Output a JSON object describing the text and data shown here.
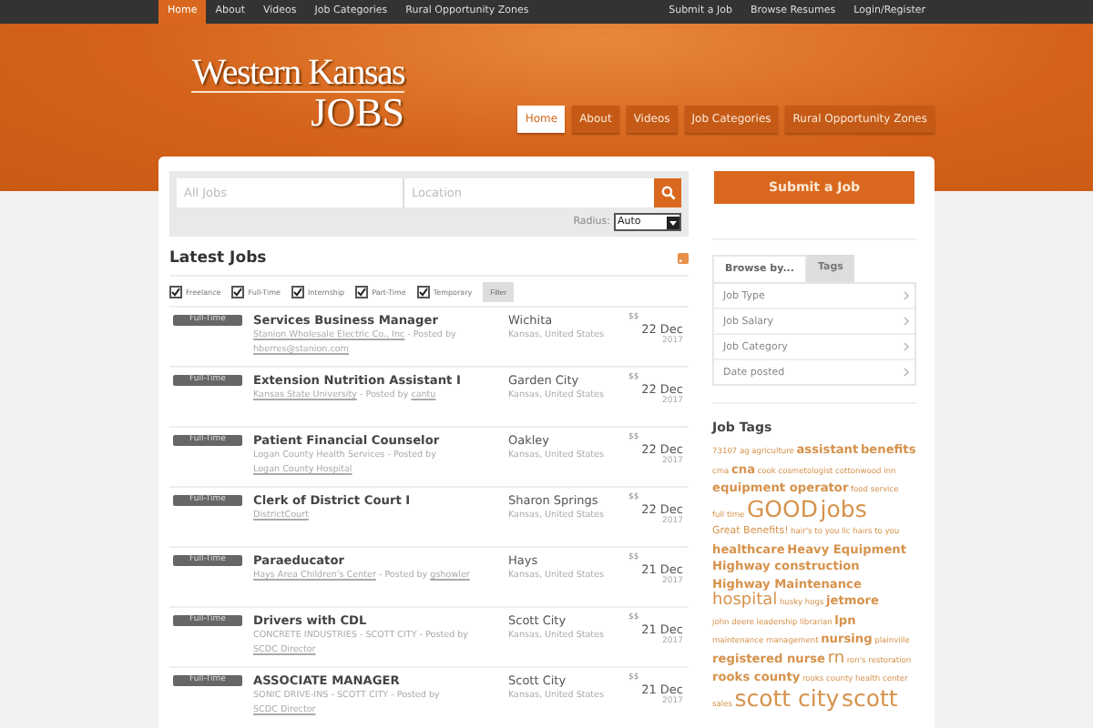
{
  "top_bar": {
    "left": [
      {
        "label": "Home",
        "selected": true
      },
      {
        "label": "About",
        "selected": false
      },
      {
        "label": "Videos",
        "selected": false
      },
      {
        "label": "Job Categories",
        "selected": false
      },
      {
        "label": "Rural Opportunity Zones",
        "selected": false
      }
    ],
    "right": [
      "Submit a Job",
      "Browse Resumes",
      "Login/Register"
    ]
  },
  "header": {
    "logo_line_1": "Western Kansas",
    "logo_line_2": "JOBS",
    "nav": [
      {
        "label": "Home",
        "selected": true
      },
      {
        "label": "About",
        "selected": false
      },
      {
        "label": "Videos",
        "selected": false
      },
      {
        "label": "Job Categories",
        "selected": false
      },
      {
        "label": "Rural Opportunity Zones",
        "selected": false
      }
    ]
  },
  "search": {
    "keywords_placeholder": "All Jobs",
    "location_placeholder": "Location",
    "radius_label": "Radius:",
    "radius_value": "Auto"
  },
  "latest": {
    "title": "Latest Jobs",
    "filters": [
      {
        "label": "Freelance",
        "checked": true
      },
      {
        "label": "Full-Time",
        "checked": true
      },
      {
        "label": "Internship",
        "checked": true
      },
      {
        "label": "Part-Time",
        "checked": true
      },
      {
        "label": "Temporary",
        "checked": true
      }
    ],
    "filter_button": "Filter",
    "jobs": [
      {
        "type": "Full-Time",
        "title": "Services Business Manager",
        "company": "Stanion Wholesale Electric Co., Inc",
        "company_link": true,
        "posted_label": " - Posted by ",
        "poster": "hberres@stanion.com",
        "city": "Wichita",
        "region": "Kansas, United States",
        "salary": "$$",
        "date": "22 Dec",
        "year": "2017"
      },
      {
        "type": "Full-Time",
        "title": "Extension Nutrition Assistant I",
        "company": "Kansas State University",
        "company_link": true,
        "posted_label": " - Posted by ",
        "poster": "cantu",
        "city": "Garden City",
        "region": "Kansas, United States",
        "salary": "$$",
        "date": "22 Dec",
        "year": "2017"
      },
      {
        "type": "Full-Time",
        "title": "Patient Financial Counselor",
        "company": "Logan County Health Services",
        "company_link": false,
        "posted_label": " - Posted by ",
        "poster": "Logan County Hospital",
        "city": "Oakley",
        "region": "Kansas, United States",
        "salary": "$$",
        "date": "22 Dec",
        "year": "2017"
      },
      {
        "type": "Full-Time",
        "title": "Clerk of District Court I",
        "company": "DistrictCourt",
        "company_link": true,
        "city": "Sharon Springs",
        "region": "Kansas, United States",
        "salary": "$$",
        "date": "22 Dec",
        "year": "2017"
      },
      {
        "type": "Full-Time",
        "title": "Paraeducator",
        "company": "Hays Area Children's Center",
        "company_link": true,
        "posted_label": " - Posted by ",
        "poster": "gshowler",
        "city": "Hays",
        "region": "Kansas, United States",
        "salary": "$$",
        "date": "21 Dec",
        "year": "2017"
      },
      {
        "type": "Full-Time",
        "title": "Drivers with CDL",
        "company": "CONCRETE INDUSTRIES - SCOTT CITY",
        "company_link": false,
        "posted_label": " - Posted by ",
        "poster": "SCDC Director",
        "city": "Scott City",
        "region": "Kansas, United States",
        "salary": "$$",
        "date": "21 Dec",
        "year": "2017"
      },
      {
        "type": "Full-Time",
        "title": "ASSOCIATE MANAGER",
        "company": "SONIC DRIVE-INS - SCOTT CITY",
        "company_link": false,
        "posted_label": " - Posted by ",
        "poster": "SCDC Director",
        "city": "Scott City",
        "region": "Kansas, United States",
        "salary": "$$",
        "date": "21 Dec",
        "year": "2017"
      }
    ]
  },
  "sidebar": {
    "submit_button": "Submit a Job",
    "tabs": [
      {
        "label": "Browse by...",
        "selected": true
      },
      {
        "label": "Tags",
        "selected": false
      }
    ],
    "browse_items": [
      "Job Type",
      "Job Salary",
      "Job Category",
      "Date posted"
    ],
    "tags_title": "Job Tags",
    "tags": [
      {
        "label": "73107",
        "kind": "small"
      },
      {
        "label": "ag",
        "kind": "small"
      },
      {
        "label": "agriculture",
        "kind": "small"
      },
      {
        "label": "assistant",
        "kind": "medium"
      },
      {
        "label": "benefits",
        "kind": "medium"
      },
      {
        "label": "cma",
        "kind": "small"
      },
      {
        "label": "cna",
        "kind": "medium"
      },
      {
        "label": "cook",
        "kind": "small"
      },
      {
        "label": "cosmetologist",
        "kind": "small"
      },
      {
        "label": "cottonwood inn",
        "kind": "small"
      },
      {
        "label": "equipment operator",
        "kind": "medium"
      },
      {
        "label": "food service",
        "kind": "small"
      },
      {
        "label": "full time",
        "kind": "small"
      },
      {
        "label": "GOOD",
        "kind": "xlarge"
      },
      {
        "label": "jobs",
        "kind": "xlarge"
      },
      {
        "label": "Great Benefits!",
        "kind": "normal"
      },
      {
        "label": "hair's to you",
        "kind": "small"
      },
      {
        "label": "llc hairs to you",
        "kind": "small"
      },
      {
        "label": "healthcare",
        "kind": "medium"
      },
      {
        "label": "Heavy Equipment",
        "kind": "medium"
      },
      {
        "label": "Highway construction",
        "kind": "medium"
      },
      {
        "label": "Highway Maintenance",
        "kind": "medium"
      },
      {
        "label": "hospital",
        "kind": "large"
      },
      {
        "label": "husky hogs",
        "kind": "small"
      },
      {
        "label": "jetmore",
        "kind": "medium"
      },
      {
        "label": "john deere",
        "kind": "small"
      },
      {
        "label": "leadership",
        "kind": "small"
      },
      {
        "label": "librarian",
        "kind": "small"
      },
      {
        "label": "lpn",
        "kind": "medium"
      },
      {
        "label": "maintenance management",
        "kind": "small"
      },
      {
        "label": "nursing",
        "kind": "medium"
      },
      {
        "label": "plainville",
        "kind": "small"
      },
      {
        "label": "registered nurse",
        "kind": "medium"
      },
      {
        "label": "rn",
        "kind": "large"
      },
      {
        "label": "ron's restoration",
        "kind": "small"
      },
      {
        "label": "rooks county",
        "kind": "medium"
      },
      {
        "label": "rooks county health center",
        "kind": "small"
      },
      {
        "label": "sales",
        "kind": "small"
      },
      {
        "label": "scott city",
        "kind": "xlarge"
      },
      {
        "label": "scott",
        "kind": "xlarge"
      }
    ]
  }
}
